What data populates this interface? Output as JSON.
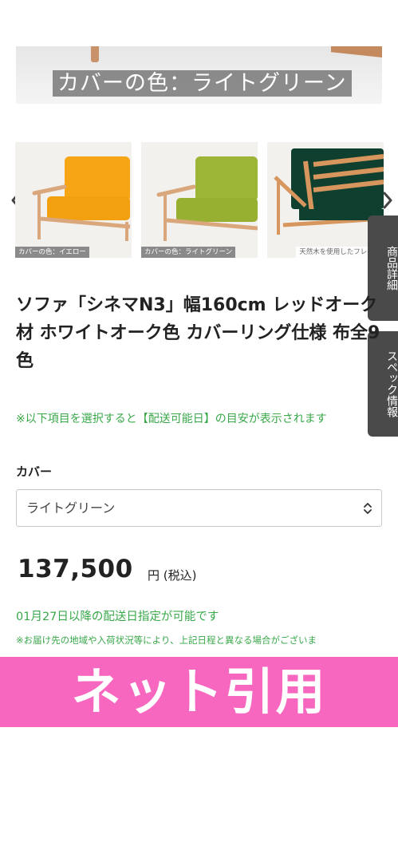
{
  "hero": {
    "caption": "カバーの色：ライトグリーン"
  },
  "gallery": {
    "prev_icon": "chevron-left-icon",
    "next_icon": "chevron-right-icon",
    "thumbnails": [
      {
        "caption": "カバーの色：イエロー",
        "cushion_color": "#f6a515",
        "frame_color": "#d9a77b"
      },
      {
        "caption": "カバーの色：ライトグリーン",
        "cushion_color": "#9cb537",
        "frame_color": "#d9a77b"
      },
      {
        "caption": "天然木を使用したフレーム",
        "cushion_color": "#0f3f2e",
        "frame_color": "#d6965e"
      }
    ]
  },
  "side_tabs": [
    {
      "label": "商品詳細"
    },
    {
      "label": "スペック情報"
    }
  ],
  "product": {
    "title": "ソファ「シネマN3」幅160cm レッドオーク材 ホワイトオーク色 カバーリング仕様 布全9色",
    "notice": "※以下項目を選択すると【配送可能日】の目安が表示されます",
    "cover_label": "カバー",
    "cover_selected": "ライトグリーン",
    "price": "137,500",
    "price_unit": "円 (税込)",
    "delivery": "01月27日以降の配送日指定が可能です",
    "disclaimer": "※お届け先の地域や入荷状況等により、上記日程と異なる場合がございま"
  },
  "overlay": {
    "text": "ネット引用",
    "color": "#f766bf"
  },
  "colors": {
    "accent_green": "#39a84a",
    "tab_bg": "#4a4a4a"
  }
}
